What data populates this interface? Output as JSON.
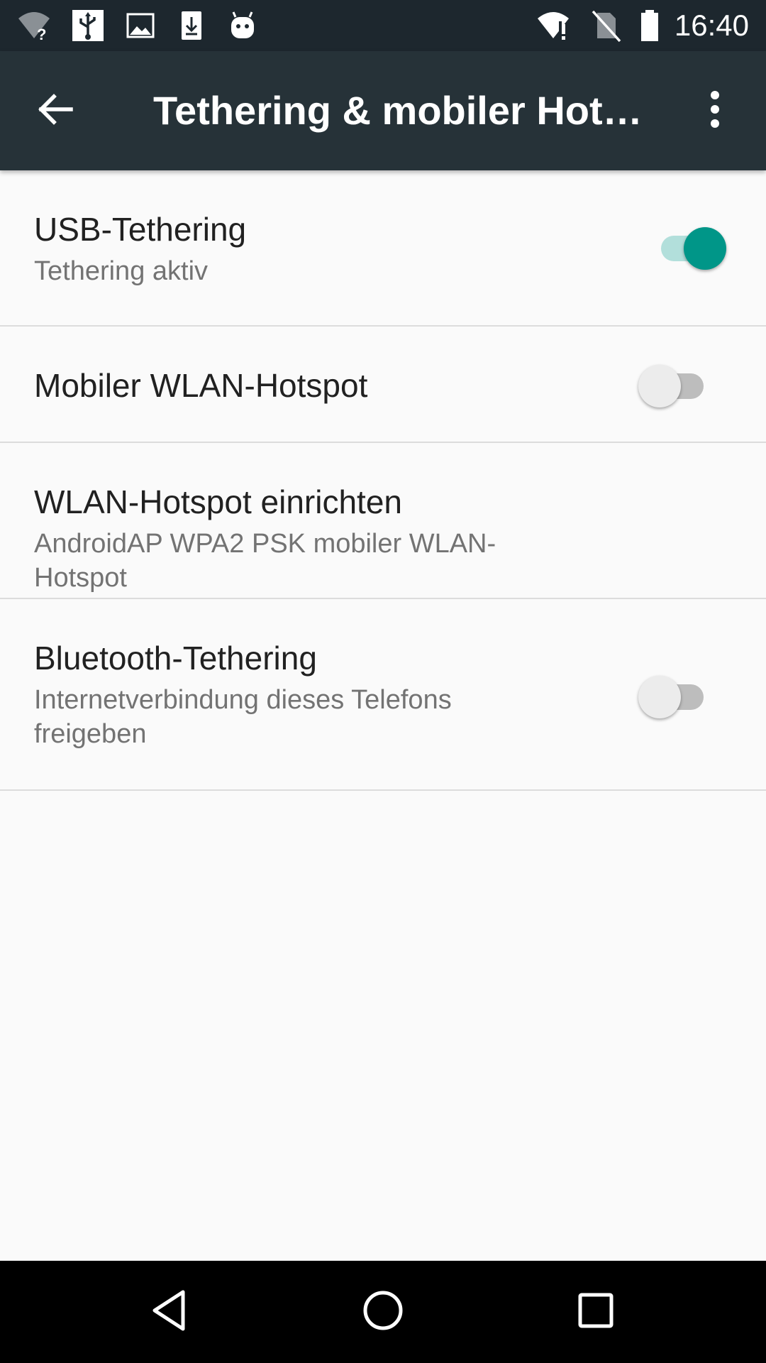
{
  "status_bar": {
    "time": "16:40",
    "left_icons": [
      "wifi-unknown-icon",
      "usb-icon",
      "image-icon",
      "download-icon",
      "android-icon"
    ],
    "right_icons": [
      "wifi-alert-icon",
      "no-sim-icon",
      "battery-icon"
    ]
  },
  "app_bar": {
    "title": "Tethering & mobiler Hotspot",
    "back_icon": "arrow-back-icon",
    "overflow_icon": "more-vert-icon",
    "background": "#263238"
  },
  "preferences": {
    "usb": {
      "title": "USB-Tethering",
      "summary": "Tethering aktiv",
      "checked": true
    },
    "hotspot": {
      "title": "Mobiler WLAN-Hotspot",
      "checked": false
    },
    "setup": {
      "title": "WLAN-Hotspot einrichten",
      "summary": "AndroidAP WPA2 PSK mobiler WLAN-Hotspot"
    },
    "bluetooth": {
      "title": "Bluetooth-Tethering",
      "summary": "Internetverbindung dieses Telefons freigeben",
      "checked": false
    }
  },
  "colors": {
    "accent": "#009688",
    "accent_track": "#b2dfdb",
    "off_thumb": "#ececec",
    "off_track": "#bdbdbd"
  },
  "nav_bar": {
    "icons": [
      "nav-back-icon",
      "nav-home-icon",
      "nav-recents-icon"
    ]
  }
}
